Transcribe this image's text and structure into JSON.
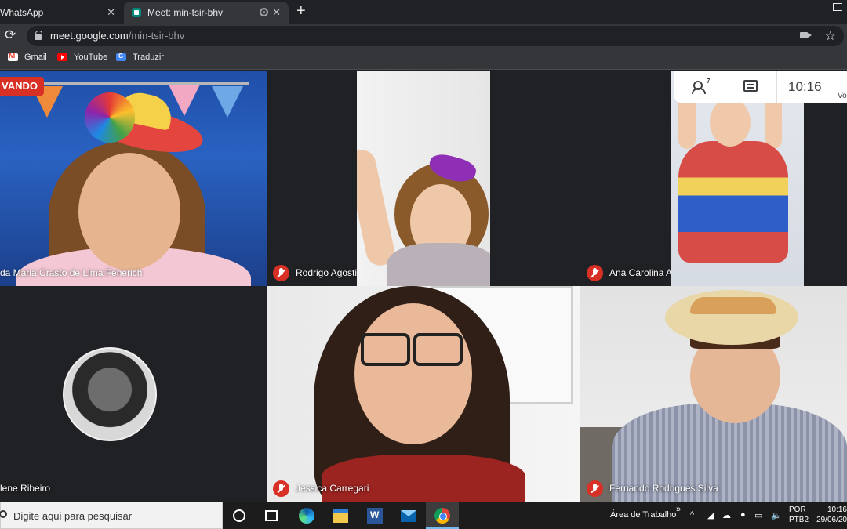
{
  "browser": {
    "tabs": [
      {
        "label": "WhatsApp"
      },
      {
        "label": "Meet: min-tsir-bhv"
      }
    ],
    "new_tab": "+",
    "url_host": "meet.google.com",
    "url_path": "/min-tsir-bhv",
    "bookmarks": [
      {
        "label": "Gmail"
      },
      {
        "label": "YouTube"
      },
      {
        "label": "Traduzir"
      }
    ]
  },
  "meet": {
    "recording_badge": "VANDO",
    "participant_count": "7",
    "time": "10:16",
    "you_label": "Vo",
    "tiles": [
      {
        "name": "da Maria Crasto de Lima Fenerich",
        "muted": false
      },
      {
        "name": "Rodrigo Agostini",
        "muted": true
      },
      {
        "name": "Ana Carolina Almeida Cordeiro",
        "muted": true
      },
      {
        "name": "lene Ribeiro",
        "muted": false
      },
      {
        "name": "Jessica Carregari",
        "muted": true
      },
      {
        "name": "Fernando Rodrigues Silva",
        "muted": true
      }
    ]
  },
  "taskbar": {
    "search_placeholder": "Digite aqui para pesquisar",
    "desktop_label": "Área de Trabalho",
    "lang_top": "POR",
    "lang_bottom": "PTB2",
    "clock_time": "10:16",
    "clock_date": "29/06/20"
  },
  "colors": {
    "mute_red": "#d93025",
    "meet_bg": "#202124",
    "chrome_tab": "#35363a"
  }
}
